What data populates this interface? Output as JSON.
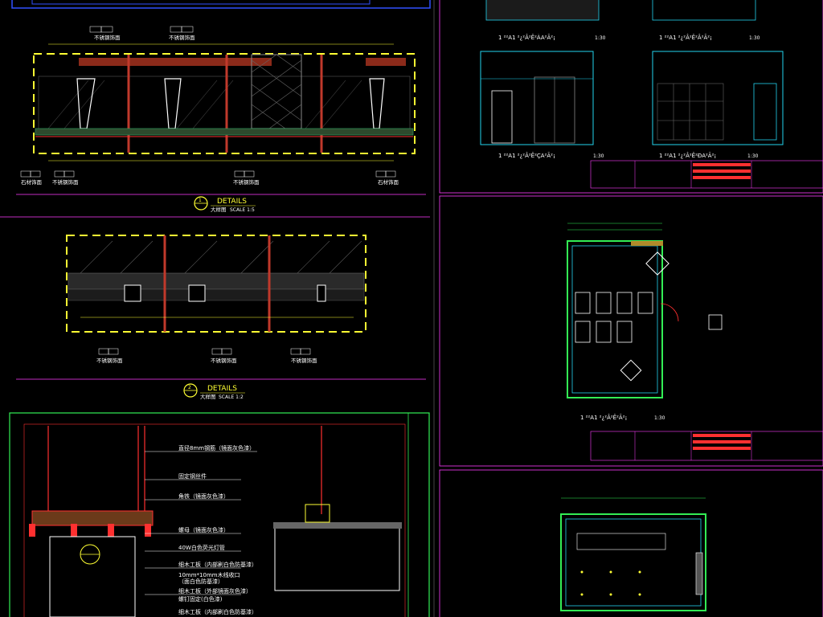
{
  "left_panel": {
    "detail_1": {
      "title": "DETAILS",
      "marker_number": "1",
      "subtitle": "大样图",
      "scale": "SCALE  1:5",
      "callouts_top": [
        "不锈钢饰面",
        "不锈钢饰面"
      ],
      "callouts_bottom": [
        "石材饰面",
        "不锈钢饰面",
        "不锈钢饰面",
        "石材饰面"
      ]
    },
    "detail_2": {
      "title": "DETAILS",
      "marker_number": "2",
      "subtitle": "大样图",
      "scale": "SCALE  1:2",
      "callouts_bottom": [
        "不锈钢饰面",
        "不锈钢饰面",
        "不锈钢饰面"
      ]
    },
    "section": {
      "labels": [
        "直径8mm钢筋（镜面灰色漆）",
        "固定钢丝件",
        "角铁（镜面灰色漆）",
        "螺母（镜面灰色漆）",
        "40W白色荧光灯管",
        "细木工板（内部刷白色防基漆）",
        "10mm*10mm木线收口",
        "（面白色防基漆）",
        "细木工板（外部镜面灰色漆）",
        "螺钉固定(白色漆)",
        "细木工板（内部刷白色防基漆）"
      ]
    }
  },
  "right_panel": {
    "elevation_top_left_title": "1 ²²A1 ²¿²Â²Ê²ÀA²Ã²¡",
    "elevation_top_left_scale": "1:30",
    "elevation_top_right_title": "1 ²²A1 ²¿²Â²Ê²Â²Ã²¡",
    "elevation_top_right_scale": "1:30",
    "elevation_mid_left_title": "1 ²²A1 ²¿²Â²Ê²ÇA²Ã²¡",
    "elevation_mid_left_scale": "1:30",
    "elevation_mid_right_title": "1 ²²A1 ²¿²Â²Ê²ÐA²Ã²¡",
    "elevation_mid_right_scale": "1:30",
    "plan_title": "1 ²²A1 ²¿²Â²Ê²Ã²¡",
    "plan_scale": "1:30"
  },
  "colors": {
    "background": "#000000",
    "yellow_dash": "#ffff33",
    "red": "#ff3030",
    "cyan": "#22d3ee",
    "green": "#33ee55",
    "white": "#ffffff",
    "magenta": "#ff3cff"
  }
}
